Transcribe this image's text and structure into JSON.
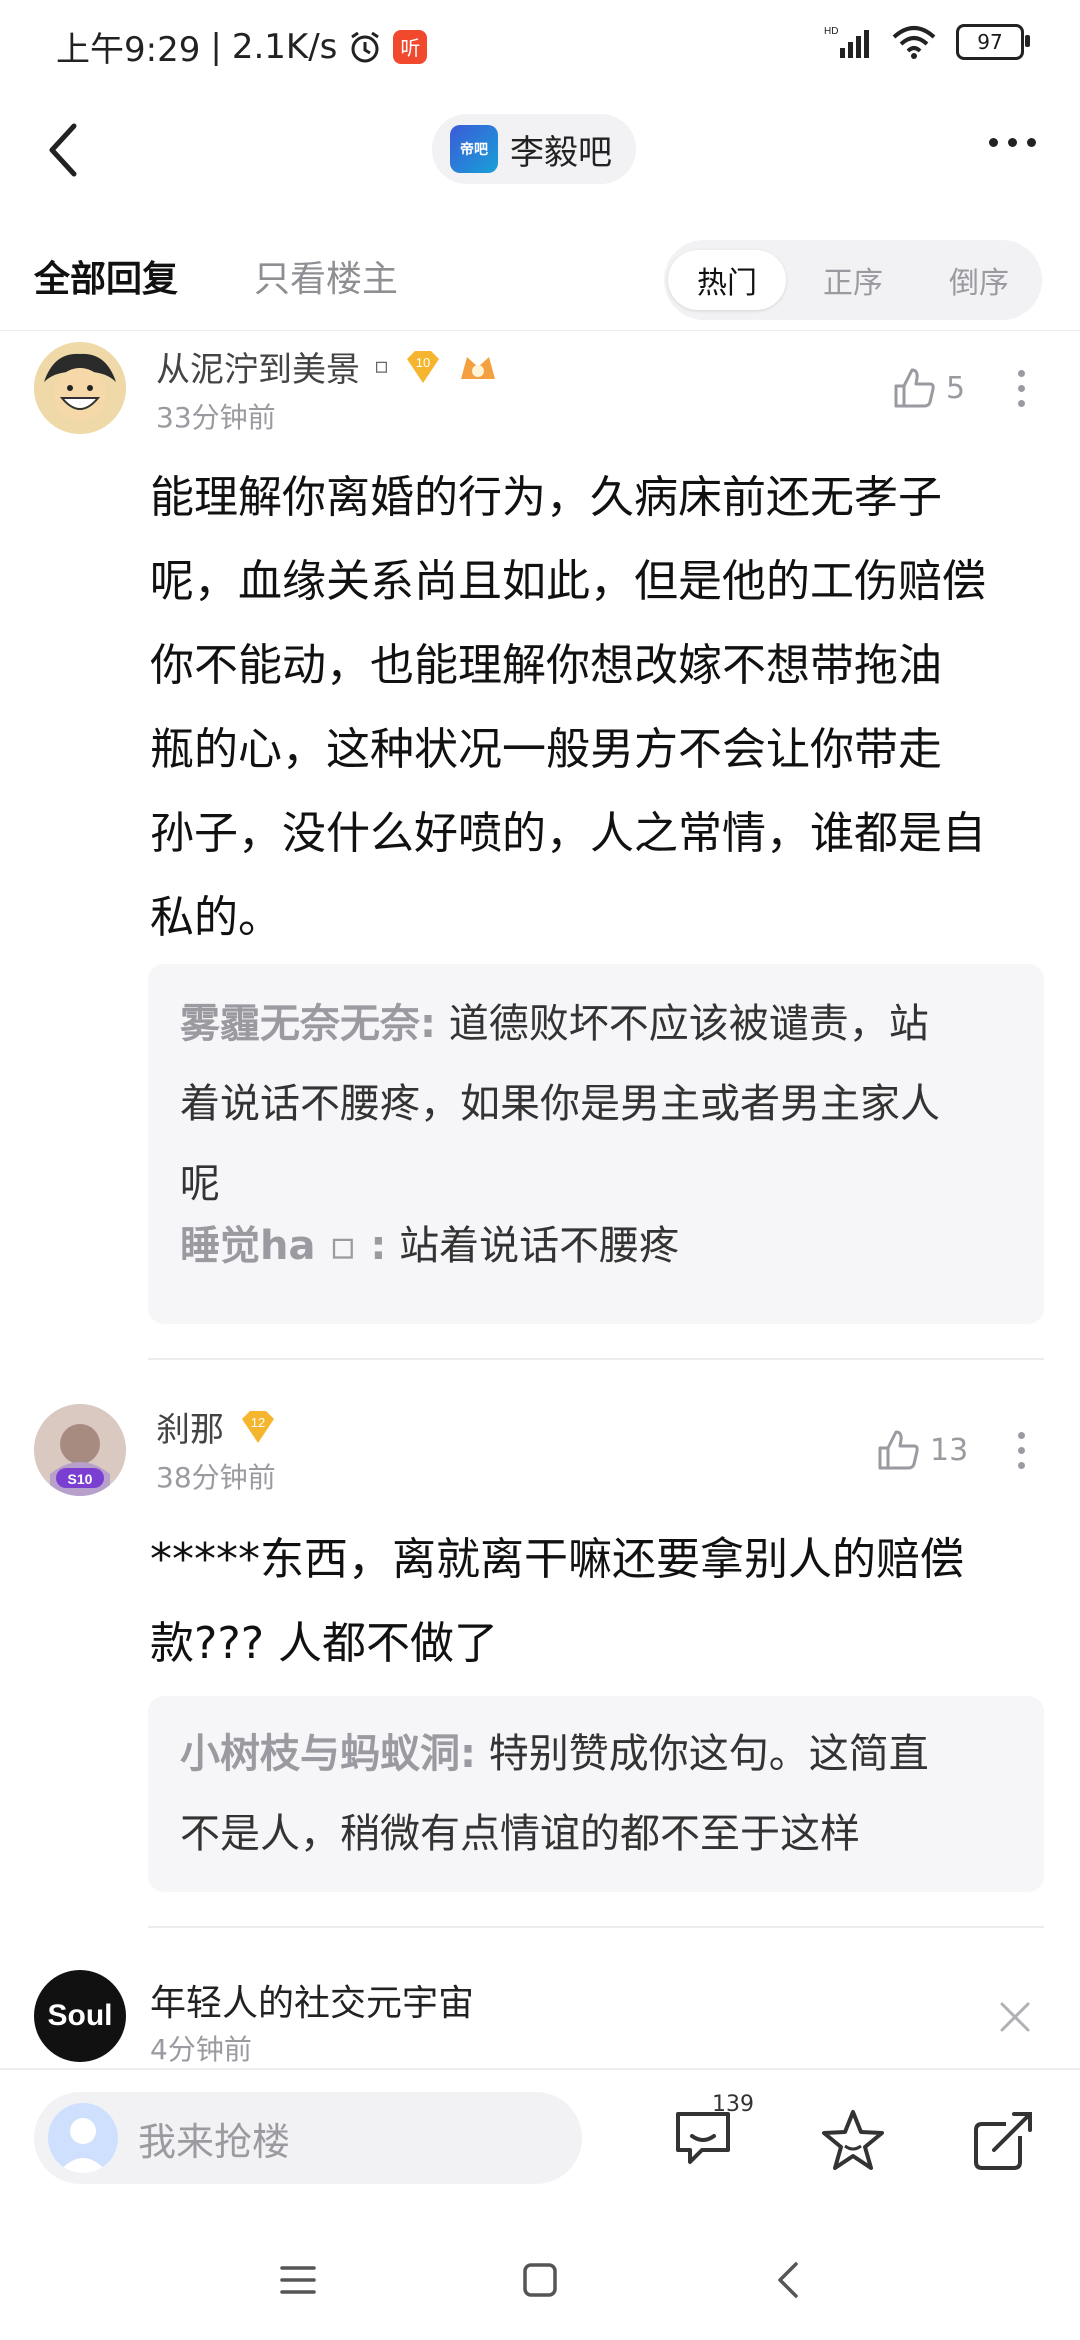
{
  "status_bar": {
    "time": "上午9:29",
    "speed": "2.1K/s",
    "listen_icon": "听",
    "network": "HD",
    "battery": "97"
  },
  "header": {
    "forum_name": "李毅吧",
    "forum_logo_text": "帝吧"
  },
  "tabs": {
    "all": "全部回复",
    "owner_only": "只看楼主",
    "sort_options": [
      "热门",
      "正序",
      "倒序"
    ]
  },
  "posts": [
    {
      "username": "从泥泞到美景",
      "username_suffix": "▫",
      "level": "10",
      "time": "33分钟前",
      "likes": "5",
      "content_lines": [
        "能理解你离婚的行为，久病床前还无孝子",
        "呢，血缘关系尚且如此，但是他的工伤赔偿",
        "你不能动，也能理解你想改嫁不想带拖油",
        "瓶的心，这种状况一般男方不会让你带走",
        "孙子，没什么好喷的，人之常情，谁都是自",
        "私的。"
      ],
      "replies": [
        {
          "name": "雾霾无奈无奈:",
          "lines": [
            " 道德败坏不应该被谴责，站",
            "着说话不腰疼，如果你是男主或者男主家人",
            "呢"
          ]
        },
        {
          "name": "睡觉ha ▫ :",
          "lines": [
            " 站着说话不腰疼"
          ]
        }
      ]
    },
    {
      "username": "刹那",
      "level": "12",
      "avatar_badge": "S10",
      "time": "38分钟前",
      "likes": "13",
      "content_lines": [
        "*****东西，离就离干嘛还要拿别人的赔偿",
        "款??? 人都不做了"
      ],
      "replies": [
        {
          "name": "小树枝与蚂蚁洞:",
          "lines": [
            " 特别赞成你这句。这简直",
            "不是人，稍微有点情谊的都不至于这样"
          ]
        }
      ]
    }
  ],
  "ad": {
    "logo_text": "Soul",
    "title": "年轻人的社交元宇宙",
    "time": "4分钟前"
  },
  "bottom_bar": {
    "placeholder": "我来抢楼",
    "comment_count": "139"
  },
  "colors": {
    "accent_gold": "#f5b52e",
    "sort_active_bg": "#ffffff",
    "quote_bg": "#f6f6f8"
  }
}
